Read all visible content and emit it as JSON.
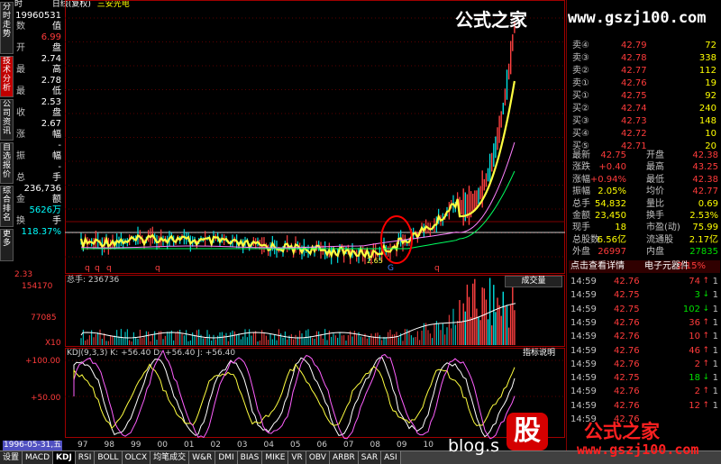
{
  "title": {
    "date": "19960531",
    "period": "日线(复权)",
    "stock": "三安光电",
    "time_label": "时"
  },
  "vtabs": [
    "分时走势",
    "技术分析",
    "公司资讯",
    "自选报价",
    "综合排名",
    "更多"
  ],
  "info": [
    {
      "k": "数",
      "v": "值",
      "c": "wht"
    },
    {
      "k": "",
      "v": "6.99",
      "c": "red"
    },
    {
      "k": "开",
      "v": "盘",
      "c": "wht"
    },
    {
      "k": "",
      "v": "2.74",
      "c": "wht"
    },
    {
      "k": "最",
      "v": "高",
      "c": "wht"
    },
    {
      "k": "",
      "v": "2.78",
      "c": "wht"
    },
    {
      "k": "最",
      "v": "低",
      "c": "wht"
    },
    {
      "k": "",
      "v": "2.53",
      "c": "wht"
    },
    {
      "k": "收",
      "v": "盘",
      "c": "wht"
    },
    {
      "k": "",
      "v": "2.67",
      "c": "wht"
    },
    {
      "k": "涨",
      "v": "幅",
      "c": "wht"
    },
    {
      "k": "",
      "v": "-",
      "c": "wht"
    },
    {
      "k": "振",
      "v": "幅",
      "c": "wht"
    },
    {
      "k": "",
      "v": "-",
      "c": "wht"
    },
    {
      "k": "总",
      "v": "手",
      "c": "wht"
    },
    {
      "k": "",
      "v": "236,736",
      "c": "wht"
    },
    {
      "k": "金",
      "v": "额",
      "c": "wht"
    },
    {
      "k": "",
      "v": "5626万",
      "c": "cyan"
    },
    {
      "k": "换",
      "v": "手",
      "c": "wht"
    },
    {
      "k": "",
      "v": "118.37%",
      "c": "cyan"
    }
  ],
  "price_axis": {
    "low": "2.33"
  },
  "volume": {
    "header": "总手: 236736",
    "indicator": "成交量",
    "ticks": [
      "154170",
      "77085",
      "X10"
    ]
  },
  "kdj": {
    "header": "KDJ(9,3,3)  K: +56.40  D: +56.40  J: +56.40",
    "explain": "指标说明",
    "ticks": [
      "+100.00",
      "+50.00"
    ]
  },
  "xaxis": {
    "date": "1996-05-31,五",
    "years": [
      "97",
      "98",
      "99",
      "00",
      "01",
      "02",
      "03",
      "04",
      "05",
      "06",
      "07",
      "08",
      "09",
      "10"
    ]
  },
  "annotations": {
    "markers": [
      "q",
      "q",
      "q",
      "q",
      "q",
      "G",
      "q"
    ],
    "low_label": "2.65"
  },
  "orderbook": {
    "asks": [
      {
        "l": "卖④",
        "p": "42.79",
        "q": "72"
      },
      {
        "l": "卖③",
        "p": "42.78",
        "q": "338"
      },
      {
        "l": "卖②",
        "p": "42.77",
        "q": "112"
      },
      {
        "l": "卖①",
        "p": "42.76",
        "q": "19"
      }
    ],
    "bids": [
      {
        "l": "买①",
        "p": "42.75",
        "q": "92"
      },
      {
        "l": "买②",
        "p": "42.74",
        "q": "240"
      },
      {
        "l": "买③",
        "p": "42.73",
        "q": "148"
      },
      {
        "l": "买④",
        "p": "42.72",
        "q": "10"
      },
      {
        "l": "买⑤",
        "p": "42.71",
        "q": "20"
      }
    ]
  },
  "quote": [
    {
      "a": "最新",
      "av": "42.75",
      "ac": "red",
      "b": "开盘",
      "bv": "42.38",
      "bc": "red"
    },
    {
      "a": "涨跌",
      "av": "+0.40",
      "ac": "red",
      "b": "最高",
      "bv": "43.25",
      "bc": "red"
    },
    {
      "a": "涨幅",
      "av": "+0.94%",
      "ac": "red",
      "b": "最低",
      "bv": "42.38",
      "bc": "red"
    },
    {
      "a": "振幅",
      "av": "2.05%",
      "ac": "yel",
      "b": "均价",
      "bv": "42.77",
      "bc": "red"
    },
    {
      "a": "总手",
      "av": "54,832",
      "ac": "yel",
      "b": "量比",
      "bv": "0.69",
      "bc": "yel"
    },
    {
      "a": "金额",
      "av": "23,450",
      "ac": "yel",
      "b": "换手",
      "bv": "2.53%",
      "bc": "yel"
    },
    {
      "a": "现手",
      "av": "18",
      "ac": "yel",
      "b": "市盈(动)",
      "bv": "75.99",
      "bc": "yel"
    },
    {
      "a": "总股数",
      "av": "6.56亿",
      "ac": "yel",
      "b": "流通股",
      "bv": "2.17亿",
      "bc": "yel"
    },
    {
      "a": "外盘",
      "av": "26997",
      "ac": "red",
      "b": "内盘",
      "bv": "27835",
      "bc": "grn"
    }
  ],
  "tools": {
    "detail": "点击查看详情",
    "sector": "电子元器件",
    "sector_pct": "2.15%"
  },
  "ticks": [
    {
      "t": "14:59",
      "p": "42.76",
      "v": "74",
      "c": "red",
      "a": "↑",
      "n": "1"
    },
    {
      "t": "14:59",
      "p": "42.75",
      "v": "3",
      "c": "grn",
      "a": "↓",
      "n": "1"
    },
    {
      "t": "14:59",
      "p": "42.75",
      "v": "102",
      "c": "grn",
      "a": "↓",
      "n": "1"
    },
    {
      "t": "14:59",
      "p": "42.76",
      "v": "36",
      "c": "red",
      "a": "↑",
      "n": "1"
    },
    {
      "t": "14:59",
      "p": "42.76",
      "v": "10",
      "c": "red",
      "a": "↑",
      "n": "1"
    },
    {
      "t": "14:59",
      "p": "42.76",
      "v": "46",
      "c": "red",
      "a": "↑",
      "n": "1"
    },
    {
      "t": "14:59",
      "p": "42.76",
      "v": "2",
      "c": "red",
      "a": "↑",
      "n": "1"
    },
    {
      "t": "14:59",
      "p": "42.75",
      "v": "18",
      "c": "grn",
      "a": "↓",
      "n": "1"
    },
    {
      "t": "14:59",
      "p": "42.76",
      "v": "2",
      "c": "red",
      "a": "↑",
      "n": "1"
    },
    {
      "t": "14:59",
      "p": "42.76",
      "v": "12",
      "c": "red",
      "a": "↑",
      "n": "1"
    },
    {
      "t": "14:59",
      "p": "42.76",
      "v": "",
      "c": "red",
      "a": "",
      "n": ""
    }
  ],
  "btabs": [
    "设置",
    "MACD",
    "KDJ",
    "RSI",
    "BOLL",
    "OLCX",
    "均笔成交",
    "W&R",
    "DMI",
    "BIAS",
    "MIKE",
    "VR",
    "OBV",
    "ARBR",
    "SAR",
    "ASI"
  ],
  "watermark": {
    "top_cn": "公式之家",
    "top_url": "www.gszj100.com",
    "bot_big": "股",
    "bot_cn": "公式之家",
    "bot_url": "www.gszj100.com",
    "blog": "blog.s"
  }
}
